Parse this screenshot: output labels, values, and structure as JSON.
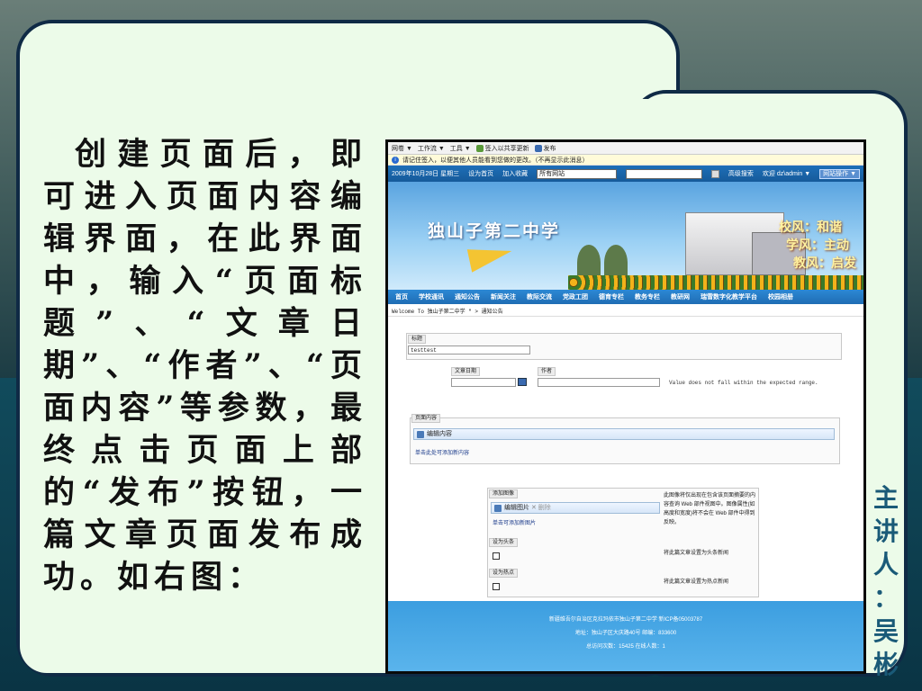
{
  "slide": {
    "body_text": "创建页面后，即可进入页面内容编辑界面，在此界面中，输入“页面标题”、“文章日期”、“作者”、“页面内容”等参数，最终点击页面上部的“发布”按钮，一篇文章页面发布成功。如右图：",
    "speaker": [
      "主",
      "讲",
      "人",
      "：",
      "吴",
      "彬"
    ]
  },
  "screenshot": {
    "ie_toolbar": [
      "网卷 ▼",
      "工作流 ▼",
      "工具 ▼",
      "签入以共享更新",
      "发布"
    ],
    "info_bar": "请记住签入，以便其他人员能看到您做的更改。（不再显示此消息）",
    "site_nav": {
      "date": "2009年10月28日 星期三",
      "home": "设为首页",
      "favorites": "加入收藏",
      "scope": "所有网站",
      "search": "高级搜索",
      "welcome": "欢迎 dz\\admin ▼",
      "actions": "网站操作 ▼"
    },
    "banner": {
      "school": "独山子第二中学",
      "motto": [
        "校风：和谐",
        "学风：主动",
        "教风：启发"
      ]
    },
    "menu": [
      "首页",
      "学校通讯",
      "通知公告",
      "新闻关注",
      "教际交流",
      "党政工团",
      "德育专栏",
      "教务专栏",
      "教研网",
      "瑞雪数字化教学平台",
      "校园相册"
    ],
    "breadcrumb": "Welcome To 独山子第二中学 \" > 通知公告",
    "form": {
      "title_label": "标题",
      "title_value": "testtest",
      "date_label": "文章日期",
      "author_label": "作者",
      "error": "Value does not fall within the expected range.",
      "content_label": "页面内容",
      "edit_content": "编辑内容",
      "add_content": "单击此处可添加新内容",
      "image_label": "添加图像",
      "edit_image": "编辑图片",
      "delete": "删除",
      "add_image": "单击可添加新图片",
      "image_note": "此图像将仅出现在包含该页面摘要的内容查询 Web 部件视图中。图像属性(如高度和宽度)将不会在 Web 部件中得到反映。",
      "headline_label": "设为头条",
      "headline_note": "将此篇文章设置为头条新闻",
      "hot_label": "设为热点",
      "hot_note": "将此篇文章设置为热点新闻"
    },
    "footer": [
      "新疆维吾尔自治区克拉玛依市独山子第二中学 新ICP备05003787",
      "地址：独山子区大庆路40号    邮编：833600",
      "总访问次数：15425    在线人数：1"
    ]
  }
}
